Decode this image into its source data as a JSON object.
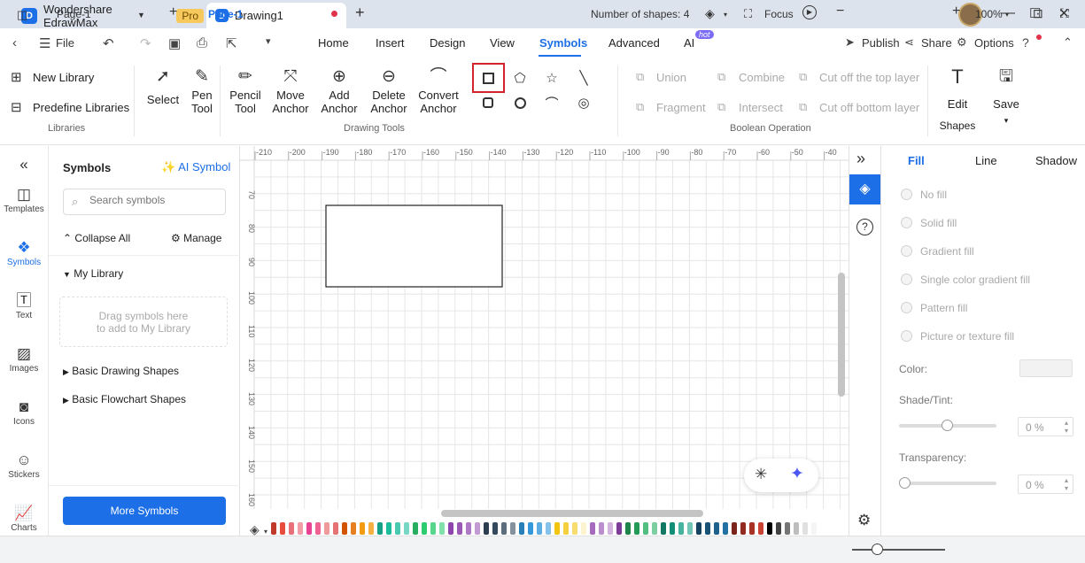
{
  "titlebar": {
    "app_name": "Wondershare EdrawMax",
    "pro_badge": "Pro",
    "doc_tab": "Drawing1",
    "new_tab": "+",
    "window_controls": [
      "—",
      "☐",
      "✕"
    ]
  },
  "menubar": {
    "file": "File",
    "tabs": [
      "Home",
      "Insert",
      "Design",
      "View",
      "Symbols",
      "Advanced",
      "AI"
    ],
    "active_tab": "Symbols",
    "ai_badge": "hot",
    "publish": "Publish",
    "share": "Share",
    "options": "Options"
  },
  "ribbon": {
    "libraries": {
      "new_library": "New Library",
      "predefine_libraries": "Predefine Libraries",
      "group": "Libraries"
    },
    "drawing_tools": {
      "select": "Select",
      "pen_tool": [
        "Pen",
        "Tool"
      ],
      "pencil_tool": [
        "Pencil",
        "Tool"
      ],
      "move_anchor": [
        "Move",
        "Anchor"
      ],
      "add_anchor": [
        "Add",
        "Anchor"
      ],
      "delete_anchor": [
        "Delete",
        "Anchor"
      ],
      "convert_anchor": [
        "Convert",
        "Anchor"
      ],
      "group": "Drawing Tools"
    },
    "boolean": {
      "union": "Union",
      "combine": "Combine",
      "cut_top": "Cut off the top layer",
      "fragment": "Fragment",
      "intersect": "Intersect",
      "cut_bottom": "Cut off bottom layer",
      "group": "Boolean Operation"
    },
    "edit_shapes": [
      "Edit",
      "Shapes"
    ],
    "save": "Save"
  },
  "leftbar": [
    "Templates",
    "Symbols",
    "Text",
    "Images",
    "Icons",
    "Stickers",
    "Charts"
  ],
  "symbols_panel": {
    "title": "Symbols",
    "ai_symbol": "AI Symbol",
    "search_placeholder": "Search symbols",
    "collapse_all": "Collapse All",
    "manage": "Manage",
    "my_library": "My Library",
    "drop_hint_1": "Drag symbols here",
    "drop_hint_2": "to add to My Library",
    "basic_drawing": "Basic Drawing Shapes",
    "basic_flowchart": "Basic Flowchart Shapes",
    "more_symbols": "More Symbols"
  },
  "ruler": {
    "h": [
      "-210",
      "-200",
      "-190",
      "-180",
      "-170",
      "-160",
      "-150",
      "-140",
      "-130",
      "-120",
      "-110",
      "-100",
      "-90",
      "-80",
      "-70",
      "-60",
      "-50",
      "-40"
    ],
    "v": [
      "70",
      "80",
      "90",
      "100",
      "110",
      "120",
      "130",
      "140",
      "150",
      "160"
    ]
  },
  "palette": [
    "#c0392b",
    "#e74c3c",
    "#e8707a",
    "#f19ca6",
    "#e84393",
    "#f06292",
    "#ef9a9a",
    "#e57373",
    "#d35400",
    "#e67e22",
    "#f39c12",
    "#f5b041",
    "#16a085",
    "#1abc9c",
    "#48c9b0",
    "#76d7c4",
    "#27ae60",
    "#2ecc71",
    "#58d68d",
    "#82e0aa",
    "#8e44ad",
    "#9b59b6",
    "#af7ac5",
    "#c39bd3",
    "#2c3e50",
    "#34495e",
    "#5d6d7e",
    "#85929e",
    "#2980b9",
    "#3498db",
    "#5dade2",
    "#85c1e9",
    "#f1c40f",
    "#f4d03f",
    "#f7dc6f",
    "#fcf3cf",
    "#a569bd",
    "#bb8fce",
    "#d2b4de",
    "#7d3c98",
    "#1e8449",
    "#239b56",
    "#52be80",
    "#7dcea0",
    "#117864",
    "#148f77",
    "#45b39d",
    "#73c6b6",
    "#154360",
    "#1a5276",
    "#1f618d",
    "#2471a3",
    "#7b241c",
    "#922b21",
    "#a93226",
    "#cb4335",
    "#000000",
    "#424242",
    "#757575",
    "#bdbdbd",
    "#e0e0e0",
    "#f5f5f5"
  ],
  "right_panel": {
    "tabs": [
      "Fill",
      "Line",
      "Shadow"
    ],
    "fill_options": [
      "No fill",
      "Solid fill",
      "Gradient fill",
      "Single color gradient fill",
      "Pattern fill",
      "Picture or texture fill"
    ],
    "color_label": "Color:",
    "shade_label": "Shade/Tint:",
    "shade_value": "0 %",
    "transparency_label": "Transparency:",
    "transparency_value": "0 %"
  },
  "statusbar": {
    "page_select": "Page-1",
    "page_tab": "Page-1",
    "shape_count": "Number of shapes: 4",
    "focus": "Focus",
    "zoom": "100%"
  }
}
